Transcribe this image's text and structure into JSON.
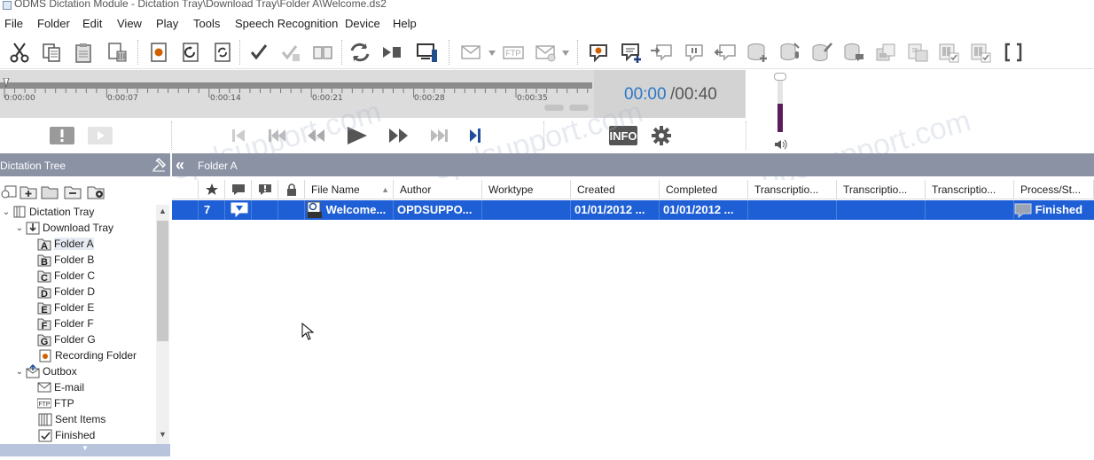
{
  "window": {
    "title": "ODMS Dictation Module - Dictation Tray\\Download Tray\\Folder A\\Welcome.ds2"
  },
  "menu": [
    "File",
    "Folder",
    "Edit",
    "View",
    "Play",
    "Tools",
    "Speech Recognition",
    "Device",
    "Help"
  ],
  "toolbar": {
    "icons": [
      "cut-icon",
      "copy-icon",
      "paste-icon",
      "delete-icon",
      "new-record-icon",
      "import-icon",
      "convert-icon",
      "finish-icon",
      "cancel-finish-icon",
      "open-book-icon",
      "sync-icon",
      "play-stop-icon",
      "send-to-device-icon",
      "email-icon",
      "ftp-icon",
      "email-options-icon",
      "record-comment-icon",
      "add-comment-icon",
      "insert-comment-icon",
      "pause-comment-icon",
      "back-comment-icon",
      "add-database-icon",
      "database-mic-icon",
      "database-edit-icon",
      "database-comment-icon",
      "folder-settings-icon",
      "folder-network-icon",
      "folder-check-icon",
      "folder-verify-icon",
      "bracket-icon"
    ],
    "ftp_label": "FTP"
  },
  "player": {
    "current_time": "00:00",
    "total_time": "/00:40",
    "ticks": [
      "0:00:00",
      "0:00:07",
      "0:00:14",
      "0:00:21",
      "0:00:28",
      "0:00:35"
    ],
    "position_fraction": 0.0
  },
  "controls": {
    "icons": [
      "priority-icon",
      "video-icon",
      "skip-start-icon",
      "rewind-start-icon",
      "rewind-icon",
      "play-icon",
      "fast-forward-icon",
      "skip-forward-icon",
      "next-index-icon",
      "info-icon",
      "settings-icon"
    ],
    "info_label": "INFO"
  },
  "volume": {
    "level_fraction": 0.48
  },
  "watermark": "opdsupport.com",
  "tree": {
    "header": "Dictation Tree",
    "nodes": [
      {
        "label": "Dictation Tray",
        "level": 0,
        "expander": "⌄",
        "icon": "tray-icon"
      },
      {
        "label": "Download Tray",
        "level": 1,
        "expander": "⌄",
        "icon": "download-tray-icon"
      },
      {
        "label": "Folder A",
        "level": 2,
        "expander": "",
        "icon": "folder-a-icon",
        "letter": "A",
        "selected": true
      },
      {
        "label": "Folder B",
        "level": 2,
        "expander": "",
        "icon": "folder-b-icon",
        "letter": "B"
      },
      {
        "label": "Folder C",
        "level": 2,
        "expander": "",
        "icon": "folder-c-icon",
        "letter": "C"
      },
      {
        "label": "Folder D",
        "level": 2,
        "expander": "",
        "icon": "folder-d-icon",
        "letter": "D"
      },
      {
        "label": "Folder E",
        "level": 2,
        "expander": "",
        "icon": "folder-e-icon",
        "letter": "E"
      },
      {
        "label": "Folder F",
        "level": 2,
        "expander": "",
        "icon": "folder-f-icon",
        "letter": "F"
      },
      {
        "label": "Folder G",
        "level": 2,
        "expander": "",
        "icon": "folder-g-icon",
        "letter": "G"
      },
      {
        "label": "Recording Folder",
        "level": 1,
        "expander": "",
        "icon": "recording-folder-icon"
      },
      {
        "label": "Outbox",
        "level": 1,
        "expander": "⌄",
        "icon": "outbox-icon"
      },
      {
        "label": "E-mail",
        "level": 2,
        "expander": "",
        "icon": "email-folder-icon"
      },
      {
        "label": "FTP",
        "level": 2,
        "expander": "",
        "icon": "ftp-folder-icon"
      },
      {
        "label": "Sent Items",
        "level": 1,
        "expander": "",
        "icon": "sent-items-icon"
      },
      {
        "label": "Finished",
        "level": 1,
        "expander": "",
        "icon": "finished-folder-icon"
      }
    ]
  },
  "folder_view": {
    "title": "Folder A",
    "columns": [
      {
        "label": "",
        "icon": "star-icon"
      },
      {
        "label": "",
        "icon": "comment-icon"
      },
      {
        "label": "",
        "icon": "alert-comment-icon"
      },
      {
        "label": "",
        "icon": "lock-icon"
      },
      {
        "label": "File Name",
        "sorted": "asc"
      },
      {
        "label": "Author"
      },
      {
        "label": "Worktype"
      },
      {
        "label": "Created"
      },
      {
        "label": "Completed"
      },
      {
        "label": "Transcriptio..."
      },
      {
        "label": "Transcriptio..."
      },
      {
        "label": "Transcriptio..."
      },
      {
        "label": "Process/St..."
      }
    ],
    "rows": [
      {
        "priority": "7",
        "file_name": "Welcome...",
        "author": "OPDSUPPO...",
        "worktype": "",
        "created": "01/01/2012 ...",
        "completed": "01/01/2012 ...",
        "t1": "",
        "t2": "",
        "t3": "",
        "status": "Finished"
      }
    ]
  }
}
